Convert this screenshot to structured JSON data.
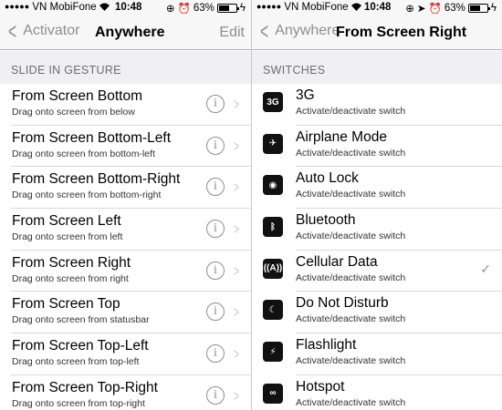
{
  "left": {
    "status": {
      "carrier": "VN MobiFone",
      "time": "10:48",
      "battery": "63%",
      "battery_level": 0.63
    },
    "nav": {
      "back": "Activator",
      "title": "Anywhere",
      "edit": "Edit"
    },
    "section": "SLIDE IN GESTURE",
    "items": [
      {
        "title": "From Screen Bottom",
        "subtitle": "Drag onto screen from below"
      },
      {
        "title": "From Screen Bottom-Left",
        "subtitle": "Drag onto screen from bottom-left"
      },
      {
        "title": "From Screen Bottom-Right",
        "subtitle": "Drag onto screen from bottom-right"
      },
      {
        "title": "From Screen Left",
        "subtitle": "Drag onto screen from left"
      },
      {
        "title": "From Screen Right",
        "subtitle": "Drag onto screen from right"
      },
      {
        "title": "From Screen Top",
        "subtitle": "Drag onto screen from statusbar"
      },
      {
        "title": "From Screen Top-Left",
        "subtitle": "Drag onto screen from top-left"
      },
      {
        "title": "From Screen Top-Right",
        "subtitle": "Drag onto screen from top-right"
      }
    ]
  },
  "right": {
    "status": {
      "carrier": "VN MobiFone",
      "time": "10:48",
      "battery": "63%",
      "battery_level": 0.63
    },
    "nav": {
      "back": "Anywhere",
      "title": "From Screen Right"
    },
    "section": "SWITCHES",
    "items": [
      {
        "title": "3G",
        "subtitle": "Activate/deactivate switch",
        "icon": "3g-icon",
        "glyph": "3G",
        "checked": false
      },
      {
        "title": "Airplane Mode",
        "subtitle": "Activate/deactivate switch",
        "icon": "airplane-icon",
        "glyph": "✈",
        "checked": false
      },
      {
        "title": "Auto Lock",
        "subtitle": "Activate/deactivate switch",
        "icon": "auto-lock-icon",
        "glyph": "◉",
        "checked": false
      },
      {
        "title": "Bluetooth",
        "subtitle": "Activate/deactivate switch",
        "icon": "bluetooth-icon",
        "glyph": "ᛒ",
        "checked": false
      },
      {
        "title": "Cellular Data",
        "subtitle": "Activate/deactivate switch",
        "icon": "cellular-data-icon",
        "glyph": "((A))",
        "checked": true
      },
      {
        "title": "Do Not Disturb",
        "subtitle": "Activate/deactivate switch",
        "icon": "moon-icon",
        "glyph": "☾",
        "checked": false
      },
      {
        "title": "Flashlight",
        "subtitle": "Activate/deactivate switch",
        "icon": "flashlight-icon",
        "glyph": "⚡",
        "checked": false
      },
      {
        "title": "Hotspot",
        "subtitle": "Activate/deactivate switch",
        "icon": "hotspot-icon",
        "glyph": "∞",
        "checked": false
      }
    ]
  }
}
